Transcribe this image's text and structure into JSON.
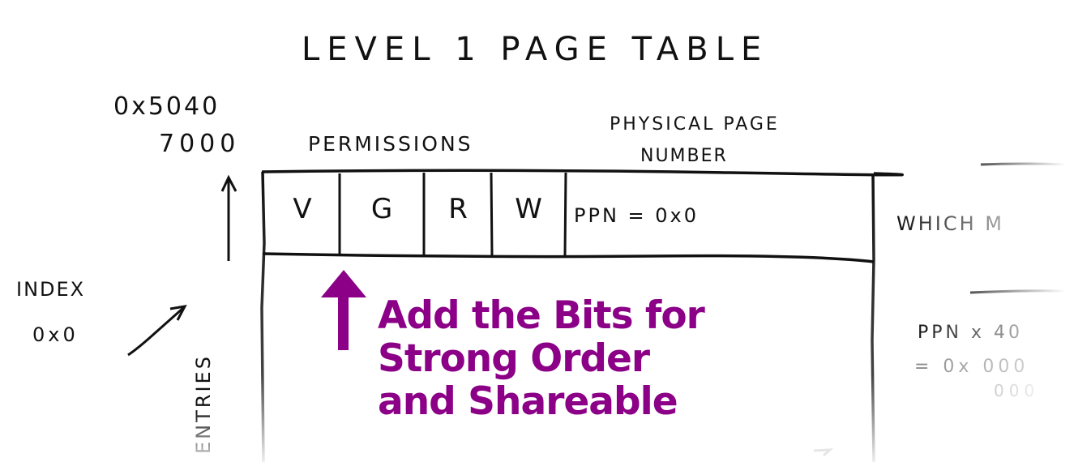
{
  "title": "LEVEL 1 PAGE TABLE",
  "base_address": {
    "line1": "0x5040",
    "line2": "7000"
  },
  "headers": {
    "permissions": "PERMISSIONS",
    "ppn_line1": "PHYSICAL PAGE",
    "ppn_line2": "NUMBER"
  },
  "entry": {
    "bits": [
      "V",
      "G",
      "R",
      "W"
    ],
    "ppn": "PPN = 0x0"
  },
  "index_label": {
    "line1": "INDEX",
    "line2": "0x0"
  },
  "entries_label": "ENTRIES",
  "side_notes": {
    "which": "WHICH M",
    "calc_line1": "PPN x 40",
    "calc_line2": "= 0x 000",
    "calc_line3": "000"
  },
  "callout": {
    "line1": "Add the Bits for",
    "line2": "Strong Order",
    "line3": "and Shareable",
    "color": "#8b0087"
  }
}
